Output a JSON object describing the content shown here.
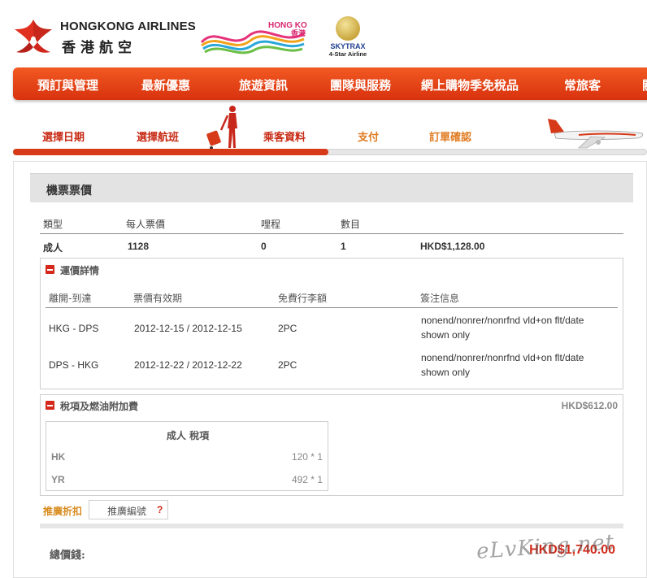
{
  "header": {
    "brand_en": "HONGKONG AIRLINES",
    "brand_zh": "香港航空",
    "hk_logo_text": "HONG KONG",
    "hk_logo_zh": "香港",
    "skytrax_name": "SKYTRAX",
    "skytrax_sub": "4-Star Airline"
  },
  "nav": {
    "items": [
      "預訂與管理",
      "最新優惠",
      "旅遊資訊",
      "團隊與服務",
      "網上購物季免稅品",
      "常旅客",
      "關"
    ]
  },
  "steps": {
    "items": [
      {
        "label": "選擇日期",
        "state": "done"
      },
      {
        "label": "選擇航班",
        "state": "done"
      },
      {
        "label": "乘客資料",
        "state": "current"
      },
      {
        "label": "支付",
        "state": "todo"
      },
      {
        "label": "訂單確認",
        "state": "todo"
      }
    ],
    "progress_fraction": 0.5
  },
  "fare": {
    "title": "機票票價",
    "columns": [
      "類型",
      "每人票價",
      "哩程",
      "數目"
    ],
    "row": {
      "type": "成人",
      "price": "1128",
      "miles": "0",
      "count": "1",
      "total": "HKD$1,128.00"
    }
  },
  "fare_details": {
    "title": "運價詳情",
    "columns": [
      "離開-到達",
      "票價有效期",
      "免費行李額",
      "簽注信息"
    ],
    "rows": [
      {
        "route": "HKG - DPS",
        "validity": "2012-12-15 / 2012-12-15",
        "baggage": "2PC",
        "endorsement_1": "nonend/nonrer/nonrfnd vld+on flt/date",
        "endorsement_2": "shown only"
      },
      {
        "route": "DPS - HKG",
        "validity": "2012-12-22 / 2012-12-22",
        "baggage": "2PC",
        "endorsement_1": "nonend/nonrer/nonrfnd vld+on flt/date",
        "endorsement_2": "shown only"
      }
    ]
  },
  "taxes": {
    "title": "稅項及燃油附加費",
    "amount": "HKD$612.00",
    "table_title": "成人 稅項",
    "rows": [
      {
        "code": "HK",
        "value": "120 * 1"
      },
      {
        "code": "YR",
        "value": "492 * 1"
      }
    ]
  },
  "promo": {
    "label": "推廣折扣",
    "placeholder": "推廣編號",
    "help": "?"
  },
  "total": {
    "label": "總價錢:",
    "value": "HKD$1,740.00"
  },
  "watermark": "eLvKing.net",
  "colors": {
    "brand_red": "#d63a18",
    "nav_orange": "#f25a22",
    "accent_orange": "#d88a1c",
    "total_red": "#d02b1b"
  }
}
